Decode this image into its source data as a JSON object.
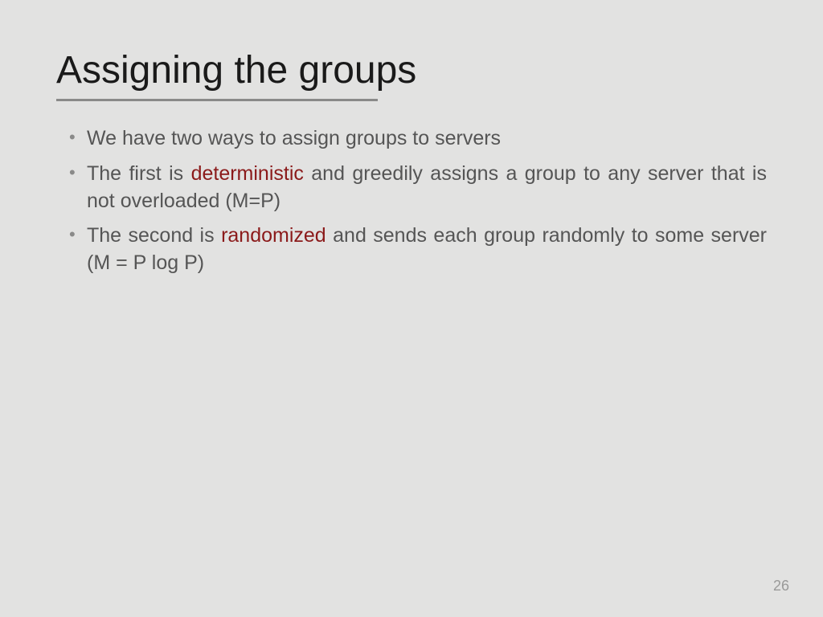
{
  "slide": {
    "title": "Assigning the groups",
    "bullets": [
      {
        "pre": "We have two ways to assign groups to servers",
        "highlight": "",
        "post": ""
      },
      {
        "pre": "The first is ",
        "highlight": "deterministic",
        "post": " and greedily assigns a group to any server that is not overloaded (M=P)"
      },
      {
        "pre": "The second is ",
        "highlight": "randomized",
        "post": " and sends each group randomly to some server (M = P log P)"
      }
    ],
    "pageNumber": "26"
  }
}
